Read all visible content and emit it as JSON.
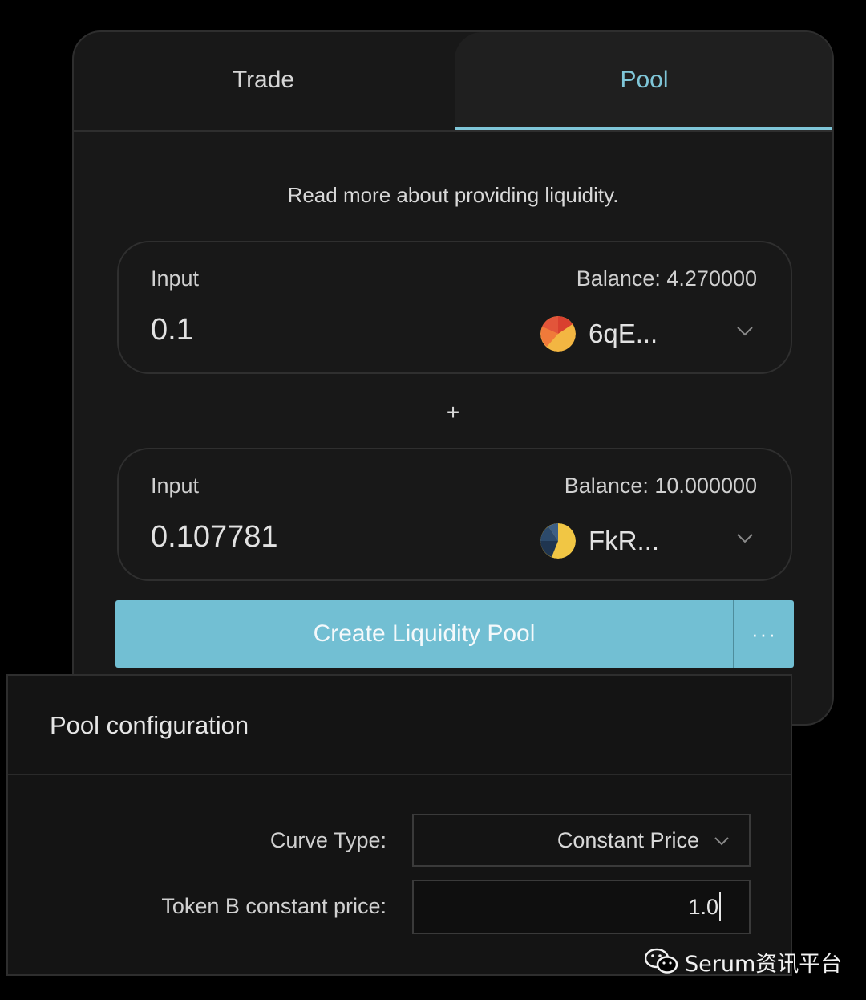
{
  "tabs": [
    {
      "label": "Trade",
      "active": false
    },
    {
      "label": "Pool",
      "active": true
    }
  ],
  "info_link": "Read more about providing liquidity.",
  "inputs": [
    {
      "label": "Input",
      "balance": "Balance: 4.270000",
      "value": "0.1",
      "token": "6qE...",
      "token_icon": "token-6qe-icon"
    },
    {
      "label": "Input",
      "balance": "Balance: 10.000000",
      "value": "0.107781",
      "token": "FkR...",
      "token_icon": "token-fkr-icon"
    }
  ],
  "plus_symbol": "+",
  "actions": {
    "create_label": "Create Liquidity Pool",
    "more_label": "···"
  },
  "pool_config": {
    "title": "Pool configuration",
    "curve_type_label": "Curve Type:",
    "curve_type_value": "Constant Price",
    "token_b_price_label": "Token B constant price:",
    "token_b_price_value": "1.0"
  },
  "watermark": {
    "text": "Serum资讯平台",
    "icon": "wechat-icon"
  },
  "colors": {
    "accent": "#7fc6d8",
    "button": "#72bfd3",
    "card_bg": "#181818",
    "page_bg": "#000000"
  }
}
